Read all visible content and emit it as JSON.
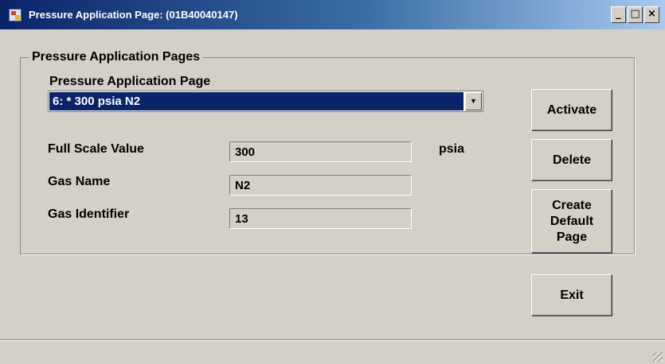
{
  "window": {
    "title": "Pressure Application Page: (01B40040147)",
    "icon": "app-icon",
    "controls": {
      "minimize": "_",
      "maximize": "□",
      "close": "×"
    }
  },
  "group": {
    "title": "Pressure Application Pages",
    "page_select": {
      "label": "Pressure Application Page",
      "value": "6: * 300 psia N2",
      "dropdown_icon": "chevron-down-icon"
    },
    "full_scale": {
      "label": "Full Scale Value",
      "value": "300",
      "unit": "psia"
    },
    "gas_name": {
      "label": "Gas Name",
      "value": "N2"
    },
    "gas_identifier": {
      "label": "Gas Identifier",
      "value": "13"
    }
  },
  "buttons": {
    "activate": "Activate",
    "delete": "Delete",
    "create_default": "Create\nDefault\nPage",
    "exit": "Exit"
  },
  "colors": {
    "titlebar_start": "#0a246a",
    "titlebar_end": "#a6caf0",
    "window_bg": "#d4d0c8",
    "selection": "#0a246a"
  }
}
